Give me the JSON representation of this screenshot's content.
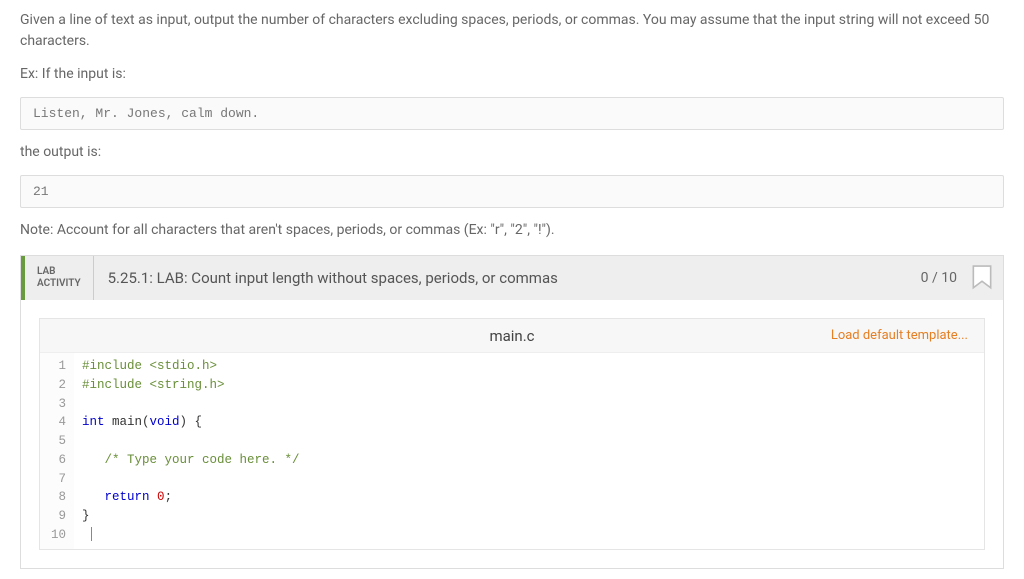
{
  "problem": {
    "description": "Given a line of text as input, output the number of characters excluding spaces, periods, or commas. You may assume that the input string will not exceed 50 characters.",
    "example_intro": "Ex: If the input is:",
    "example_input": "Listen, Mr. Jones, calm down.",
    "output_intro": "the output is:",
    "example_output": "21",
    "note": "Note: Account for all characters that aren't spaces, periods, or commas (Ex: \"r\", \"2\", \"!\")."
  },
  "lab": {
    "label_line1": "LAB",
    "label_line2": "ACTIVITY",
    "title": "5.25.1: LAB: Count input length without spaces, periods, or commas",
    "score": "0 / 10"
  },
  "editor": {
    "filename": "main.c",
    "load_template": "Load default template...",
    "code": {
      "l1_pp": "#include ",
      "l1_hdr": "<stdio.h>",
      "l2_pp": "#include ",
      "l2_hdr": "<string.h>",
      "l3": "",
      "l4_kw1": "int",
      "l4_txt1": " main(",
      "l4_kw2": "void",
      "l4_txt2": ") {",
      "l5": "",
      "l6_indent": "   ",
      "l6_cmt": "/* Type your code here. */",
      "l7": "",
      "l8_indent": "   ",
      "l8_kw": "return",
      "l8_sp": " ",
      "l8_num": "0",
      "l8_semi": ";",
      "l9": "}",
      "l10": ""
    },
    "line_numbers": [
      "1",
      "2",
      "3",
      "4",
      "5",
      "6",
      "7",
      "8",
      "9",
      "10"
    ]
  }
}
